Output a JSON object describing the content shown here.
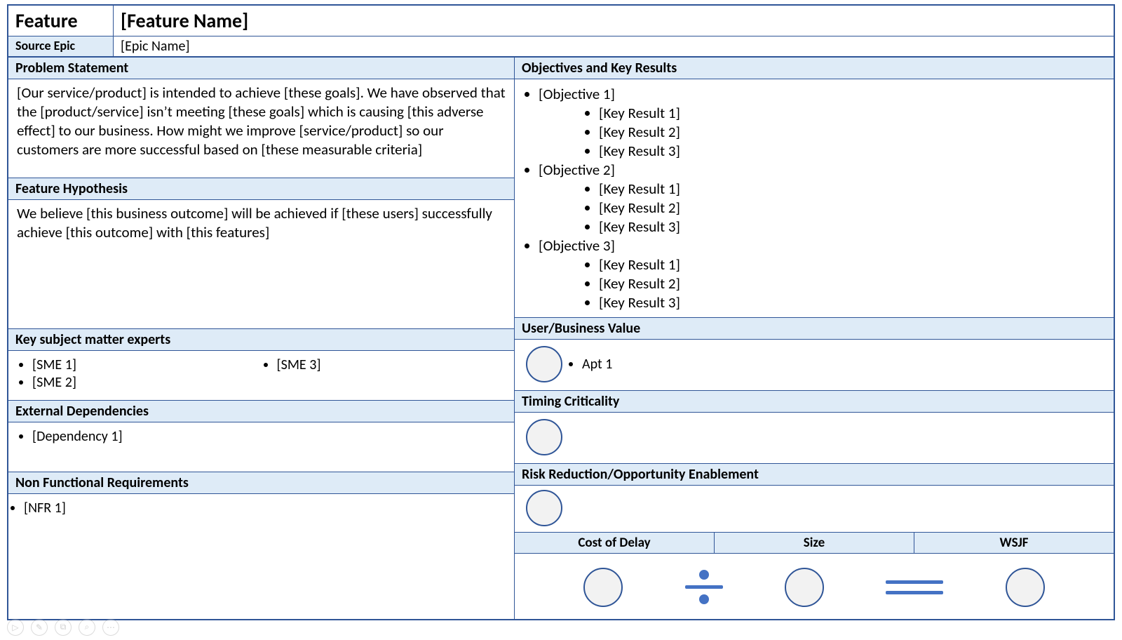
{
  "header": {
    "feature_label": "Feature",
    "feature_value": "[Feature Name]",
    "epic_label": "Source Epic",
    "epic_value": "[Epic Name]"
  },
  "left": {
    "problem_header": "Problem Statement",
    "problem_text": "[Our service/product] is intended to achieve [these goals].  We have observed that the [product/service] isn’t meeting [these goals] which is causing [this adverse effect] to our business.  How might we improve [service/product] so our customers are more successful based on [these measurable criteria]",
    "hypothesis_header": "Feature Hypothesis",
    "hypothesis_text": "We believe [this business outcome] will be achieved if [these users] successfully achieve [this outcome] with [this features]",
    "sme_header": "Key subject matter experts",
    "sme1": "[SME 1]",
    "sme2": "[SME 2]",
    "sme3": "[SME 3]",
    "dep_header": "External Dependencies",
    "dep1": "[Dependency 1]",
    "nfr_header": "Non Functional Requirements",
    "nfr1": "[NFR 1]"
  },
  "right": {
    "okr_header": "Objectives and Key Results",
    "obj1": "[Objective 1]",
    "obj2": "[Objective 2]",
    "obj3": "[Objective 3]",
    "kr1": "[Key Result 1]",
    "kr2": "[Key Result 2]",
    "kr3": "[Key Result 3]",
    "ubv_header": "User/Business Value",
    "ubv_item": "Apt 1",
    "tc_header": "Timing Criticality",
    "rroe_header": "Risk Reduction/Opportunity Enablement",
    "wsjf_col1": "Cost of Delay",
    "wsjf_col2": "Size",
    "wsjf_col3": "WSJF"
  },
  "controls": {
    "play": "▷",
    "pen": "✎",
    "cc": "⧉",
    "zoom": "⌕",
    "more": "⋯"
  }
}
